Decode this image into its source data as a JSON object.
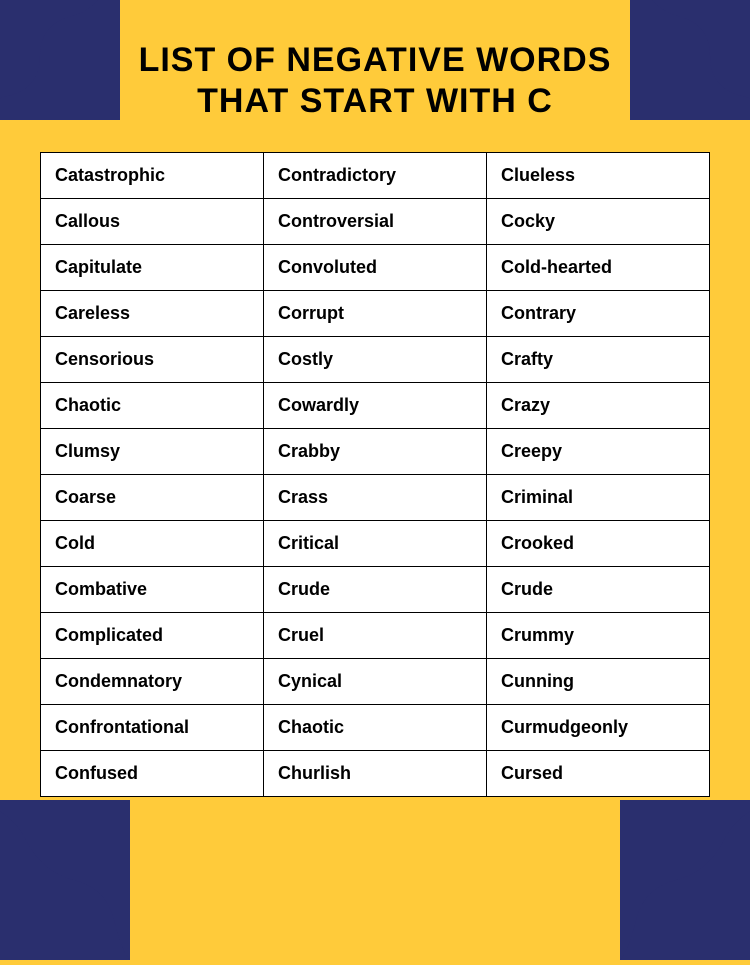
{
  "title_line1": "LIST OF NEGATIVE WORDS",
  "title_line2": "THAT START WITH C",
  "words": [
    [
      "Catastrophic",
      "Contradictory",
      "Clueless"
    ],
    [
      "Callous",
      "Controversial",
      "Cocky"
    ],
    [
      "Capitulate",
      "Convoluted",
      "Cold-hearted"
    ],
    [
      "Careless",
      "Corrupt",
      "Contrary"
    ],
    [
      "Censorious",
      "Costly",
      "Crafty"
    ],
    [
      "Chaotic",
      "Cowardly",
      "Crazy"
    ],
    [
      "Clumsy",
      "Crabby",
      "Creepy"
    ],
    [
      "Coarse",
      "Crass",
      "Criminal"
    ],
    [
      "Cold",
      "Critical",
      "Crooked"
    ],
    [
      "Combative",
      "Crude",
      "Crude"
    ],
    [
      "Complicated",
      "Cruel",
      "Crummy"
    ],
    [
      "Condemnatory",
      "Cynical",
      "Cunning"
    ],
    [
      "Confrontational",
      "Chaotic",
      "Curmudgeonly"
    ],
    [
      "Confused",
      "Churlish",
      "Cursed"
    ]
  ]
}
